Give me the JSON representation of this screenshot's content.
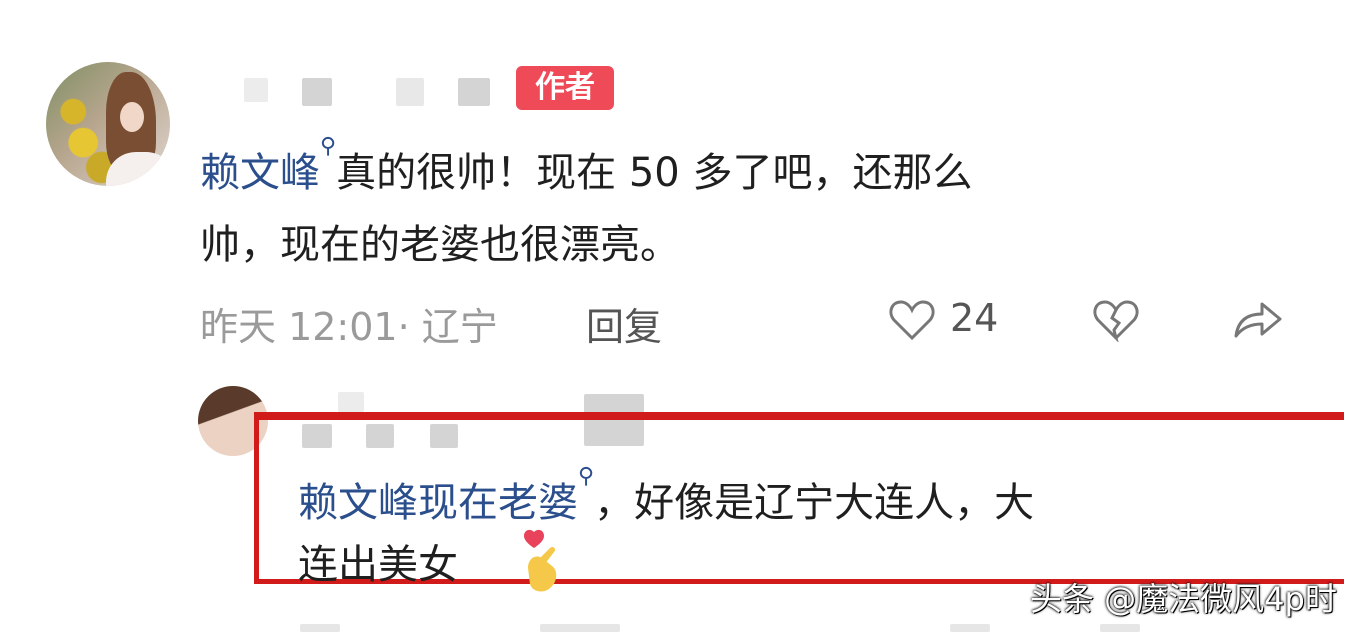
{
  "comment": {
    "badge": "作者",
    "mention": "赖文峰",
    "line1_rest": "真的很帅！现在 50 多了吧，还那么",
    "line2": "帅，现在的老婆也很漂亮。",
    "time": "昨天 12:01",
    "separator": "·",
    "location": "辽宁",
    "reply_label": "回复",
    "like_count": "24"
  },
  "reply": {
    "mention": "赖文峰现在老婆",
    "line1_rest": "，好像是辽宁大连人，大",
    "line2": "连出美女"
  },
  "watermark": "头条 @魔法微风4p时",
  "colors": {
    "badge": "#ef4a57",
    "mention": "#2b4f8c",
    "frame": "#d11b1b"
  }
}
